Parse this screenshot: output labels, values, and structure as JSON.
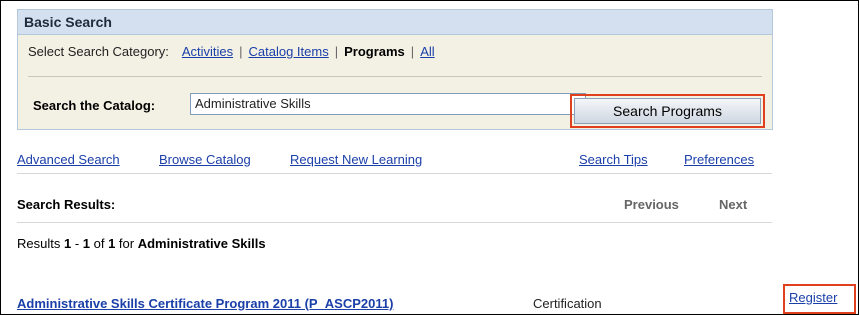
{
  "panel": {
    "title": "Basic Search",
    "category_label": "Select Search Category:",
    "categories": [
      {
        "label": "Activities",
        "current": false
      },
      {
        "label": "Catalog Items",
        "current": false
      },
      {
        "label": "Programs",
        "current": true
      },
      {
        "label": "All",
        "current": false
      }
    ],
    "search_label": "Search the Catalog:",
    "search_value": "Administrative Skills",
    "search_button": "Search Programs"
  },
  "links": {
    "advanced": "Advanced Search",
    "browse": "Browse Catalog",
    "request": "Request New Learning",
    "tips": "Search Tips",
    "preferences": "Preferences"
  },
  "results": {
    "heading": "Search Results:",
    "previous": "Previous",
    "next": "Next",
    "summary_prefix": "Results ",
    "range_start": "1",
    "range_sep": " - ",
    "range_end": "1",
    "of_text": " of ",
    "total": "1",
    "for_text": " for ",
    "query": "Administrative Skills",
    "items": [
      {
        "title": "Administrative Skills Certificate Program 2011 (P_ASCP2011)",
        "type": "Certification",
        "action": "Register"
      }
    ]
  }
}
